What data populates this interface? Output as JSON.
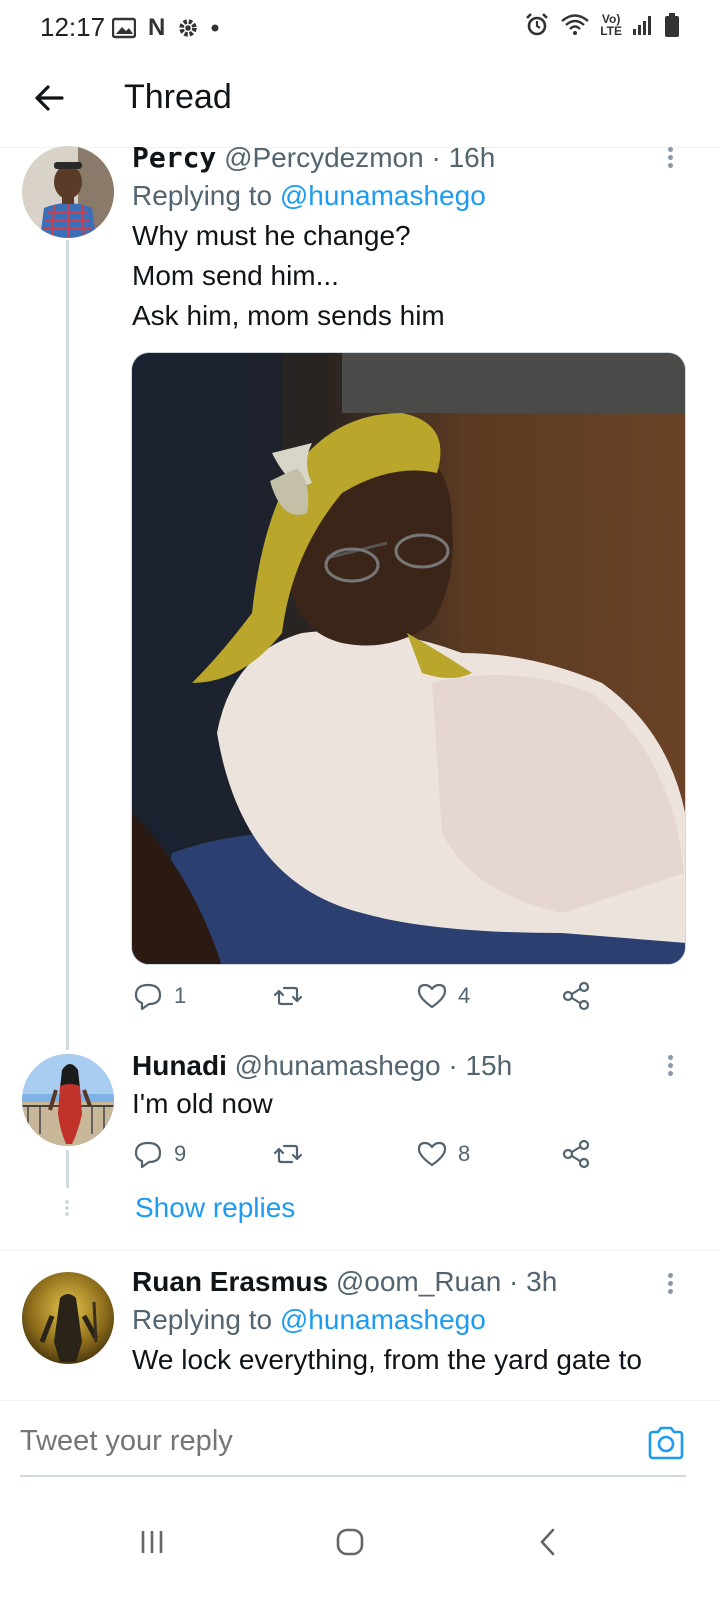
{
  "status_bar": {
    "time": "12:17",
    "left_icons": [
      "image-icon",
      "netflix-n-icon",
      "gear-icon",
      "dot-icon"
    ],
    "right_icons": [
      "alarm-icon",
      "wifi-icon",
      "volte-icon",
      "signal-icon",
      "battery-icon"
    ],
    "volte_top": "Vo)",
    "volte_bottom": "LTE",
    "n_label": "N"
  },
  "header": {
    "title": "Thread",
    "back_icon": "back-arrow-icon"
  },
  "tweets": [
    {
      "name": "Percy",
      "handle": "@Percydezmon",
      "time": "· 16h",
      "replying_label": "Replying to",
      "replying_to": "@hunamashego",
      "text_lines": [
        "Why must he change?",
        "Mom send him...",
        "Ask him, mom sends him"
      ],
      "media": "photo of elderly woman in yellow headscarf",
      "replies": "1",
      "retweets": "",
      "likes": "4"
    },
    {
      "name": "Hunadi",
      "handle": "@hunamashego",
      "time": "· 15h",
      "text_lines": [
        "I'm old now"
      ],
      "replies": "9",
      "retweets": "",
      "likes": "8",
      "show_replies": "Show replies"
    },
    {
      "name": "Ruan Erasmus",
      "handle": "@oom_Ruan",
      "time": "· 3h",
      "replying_label": "Replying to",
      "replying_to": "@hunamashego",
      "text_lines": [
        "We lock everything, from the yard gate to"
      ]
    }
  ],
  "reply_bar": {
    "placeholder": "Tweet your reply",
    "camera_icon": "camera-icon"
  },
  "nav_bar": {
    "buttons": [
      "recent-apps-icon",
      "home-icon",
      "back-icon"
    ]
  },
  "colors": {
    "accent": "#1d9bf0",
    "text_primary": "#0f1419",
    "text_secondary": "#536471",
    "thread_line": "#cfd9de"
  }
}
